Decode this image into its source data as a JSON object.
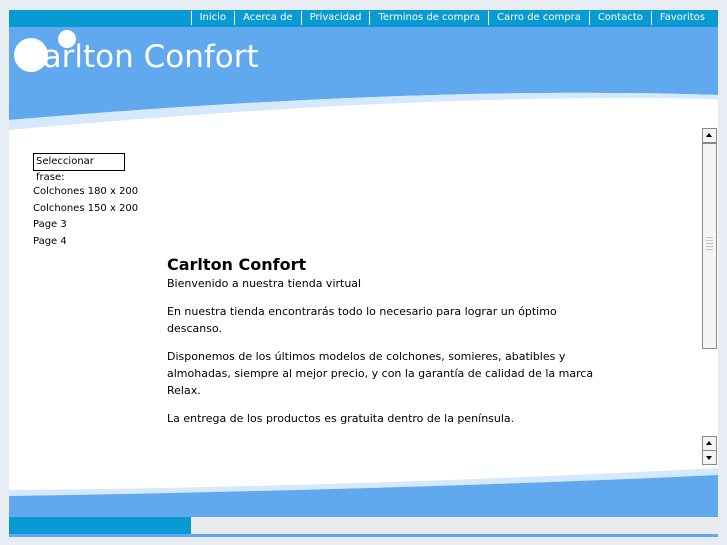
{
  "nav": {
    "items": [
      {
        "label": "Inicio"
      },
      {
        "label": "Acerca de"
      },
      {
        "label": "Privacidad"
      },
      {
        "label": "Terminos de compra"
      },
      {
        "label": "Carro de compra"
      },
      {
        "label": "Contacto"
      },
      {
        "label": "Favoritos"
      }
    ]
  },
  "header": {
    "logo_text": "Carlton Confort"
  },
  "sidebar": {
    "select_label": "Seleccionar frase:",
    "links": [
      {
        "label": "Colchones 180 x 200"
      },
      {
        "label": "Colchones 150 x 200"
      },
      {
        "label": "Page 3"
      },
      {
        "label": "Page 4"
      }
    ]
  },
  "main": {
    "title": "Carlton Confort",
    "subtitle": "Bienvenido a nuestra tienda virtual",
    "paragraphs": [
      "En nuestra tienda encontrarás todo lo necesario para lograr un óptimo descanso.",
      "Disponemos de los últimos modelos de colchones, somieres, abatibles y almohadas, siempre al mejor precio, y con la garantía de calidad de la marca Relax.",
      "La entrega de los productos es gratuita dentro de la península."
    ]
  },
  "progress": {
    "fraction": 0.256
  },
  "colors": {
    "nav_blue": "#0a9ad3",
    "header_blue": "#61a9ef",
    "wave_light": "#d6e8fb"
  },
  "icons": {
    "scroll_up": "arrow-up-icon",
    "scroll_down": "arrow-down-icon"
  }
}
